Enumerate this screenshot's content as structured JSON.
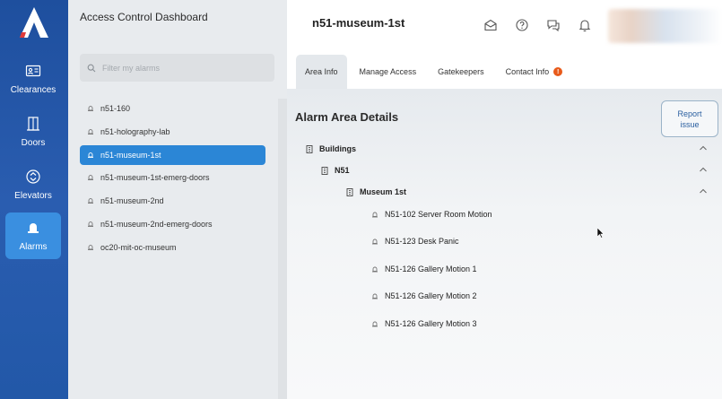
{
  "nav": {
    "items": [
      {
        "label": "Clearances",
        "icon": "id-card-icon"
      },
      {
        "label": "Doors",
        "icon": "door-icon"
      },
      {
        "label": "Elevators",
        "icon": "elevator-icon"
      },
      {
        "label": "Alarms",
        "icon": "alarm-icon"
      }
    ],
    "active": "Alarms"
  },
  "sidebar": {
    "title": "Access Control Dashboard",
    "search_placeholder": "Filter my alarms",
    "alarms": [
      "n51-160",
      "n51-holography-lab",
      "n51-museum-1st",
      "n51-museum-1st-emerg-doors",
      "n51-museum-2nd",
      "n51-museum-2nd-emerg-doors",
      "oc20-mit-oc-museum"
    ],
    "selected": "n51-museum-1st"
  },
  "header": {
    "title": "n51-museum-1st",
    "tabs": [
      {
        "label": "Area Info"
      },
      {
        "label": "Manage Access"
      },
      {
        "label": "Gatekeepers"
      },
      {
        "label": "Contact Info",
        "badge": "!"
      }
    ],
    "active_tab": "Area Info"
  },
  "main": {
    "section_title": "Alarm Area Details",
    "report_button": "Report issue",
    "tree": {
      "level1": "Buildings",
      "level2": "N51",
      "level3": "Museum 1st",
      "items": [
        "N51-102 Server Room Motion",
        "N51-123 Desk Panic",
        "N51-126 Gallery Motion 1",
        "N51-126 Gallery Motion 2",
        "N51-126 Gallery Motion 3"
      ]
    }
  },
  "colors": {
    "rail": "#2258a8",
    "active": "#3a8fe0",
    "selected": "#2b86d6",
    "badge": "#e85a1a"
  }
}
